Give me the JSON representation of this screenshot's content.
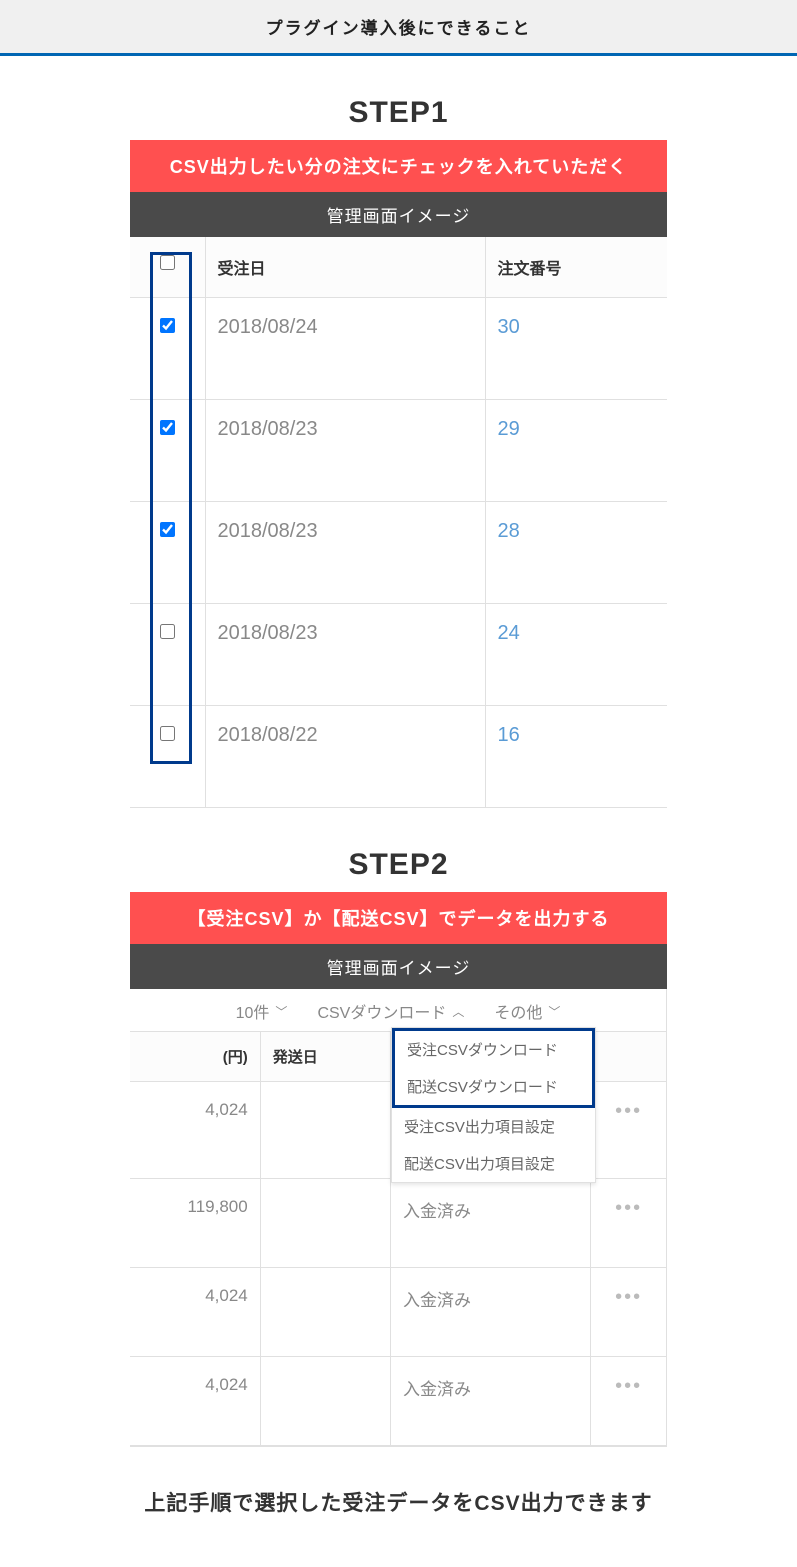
{
  "banner": "プラグイン導入後にできること",
  "step1": {
    "title": "STEP1",
    "red": "CSV出力したい分の注文にチェックを入れていただく",
    "gray": "管理画面イメージ",
    "headers": {
      "date": "受注日",
      "order": "注文番号"
    },
    "rows": [
      {
        "checked": true,
        "date": "2018/08/24",
        "num": "30"
      },
      {
        "checked": true,
        "date": "2018/08/23",
        "num": "29"
      },
      {
        "checked": true,
        "date": "2018/08/23",
        "num": "28"
      },
      {
        "checked": false,
        "date": "2018/08/23",
        "num": "24"
      },
      {
        "checked": false,
        "date": "2018/08/22",
        "num": "16"
      }
    ]
  },
  "step2": {
    "title": "STEP2",
    "red": "【受注CSV】か【配送CSV】でデータを出力する",
    "gray": "管理画面イメージ",
    "toolbar": {
      "perpage": "10件",
      "csv": "CSVダウンロード",
      "other": "その他"
    },
    "dropdown": {
      "opt1": "受注CSVダウンロード",
      "opt2": "配送CSVダウンロード",
      "opt3": "受注CSV出力項目設定",
      "opt4": "配送CSV出力項目設定"
    },
    "headers": {
      "amount": "(円)",
      "shipdate": "発送日"
    },
    "rows": [
      {
        "amount": "4,024",
        "ship": "",
        "status": "",
        "dots": "•••"
      },
      {
        "amount": "119,800",
        "ship": "",
        "status": "入金済み",
        "dots": "•••"
      },
      {
        "amount": "4,024",
        "ship": "",
        "status": "入金済み",
        "dots": "•••"
      },
      {
        "amount": "4,024",
        "ship": "",
        "status": "入金済み",
        "dots": "•••"
      }
    ]
  },
  "footer": "上記手順で選択した受注データをCSV出力できます"
}
